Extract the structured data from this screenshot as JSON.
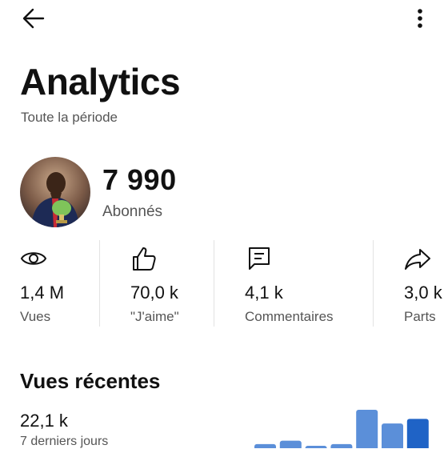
{
  "header": {
    "back_icon": "arrow-left-icon",
    "menu_icon": "more-vertical-icon"
  },
  "page": {
    "title": "Analytics",
    "subtitle": "Toute la période"
  },
  "channel": {
    "avatar_icon": "user-avatar",
    "subscribers_value": "7 990",
    "subscribers_label": "Abonnés"
  },
  "stats": [
    {
      "icon": "eye-icon",
      "value": "1,4 M",
      "label": "Vues"
    },
    {
      "icon": "thumbs-up-icon",
      "value": "70,0 k",
      "label": "\"J'aime\""
    },
    {
      "icon": "comment-icon",
      "value": "4,1 k",
      "label": "Commentaires"
    },
    {
      "icon": "share-icon",
      "value": "3,0 k",
      "label": "Parts"
    }
  ],
  "recent": {
    "title": "Vues récentes",
    "value": "22,1 k",
    "period": "7 derniers jours"
  },
  "chart_data": {
    "type": "bar",
    "values": [
      1.0,
      1.6,
      0.7,
      1.0,
      7.0,
      4.6,
      5.4
    ],
    "colors": [
      "#5b8fd9",
      "#5b8fd9",
      "#5b8fd9",
      "#5b8fd9",
      "#5b8fd9",
      "#5b8fd9",
      "#1f63c6"
    ]
  },
  "colors": {
    "text_primary": "#111111",
    "text_secondary": "#555555",
    "bar": "#5b8fd9",
    "bar_highlight": "#1f63c6"
  }
}
